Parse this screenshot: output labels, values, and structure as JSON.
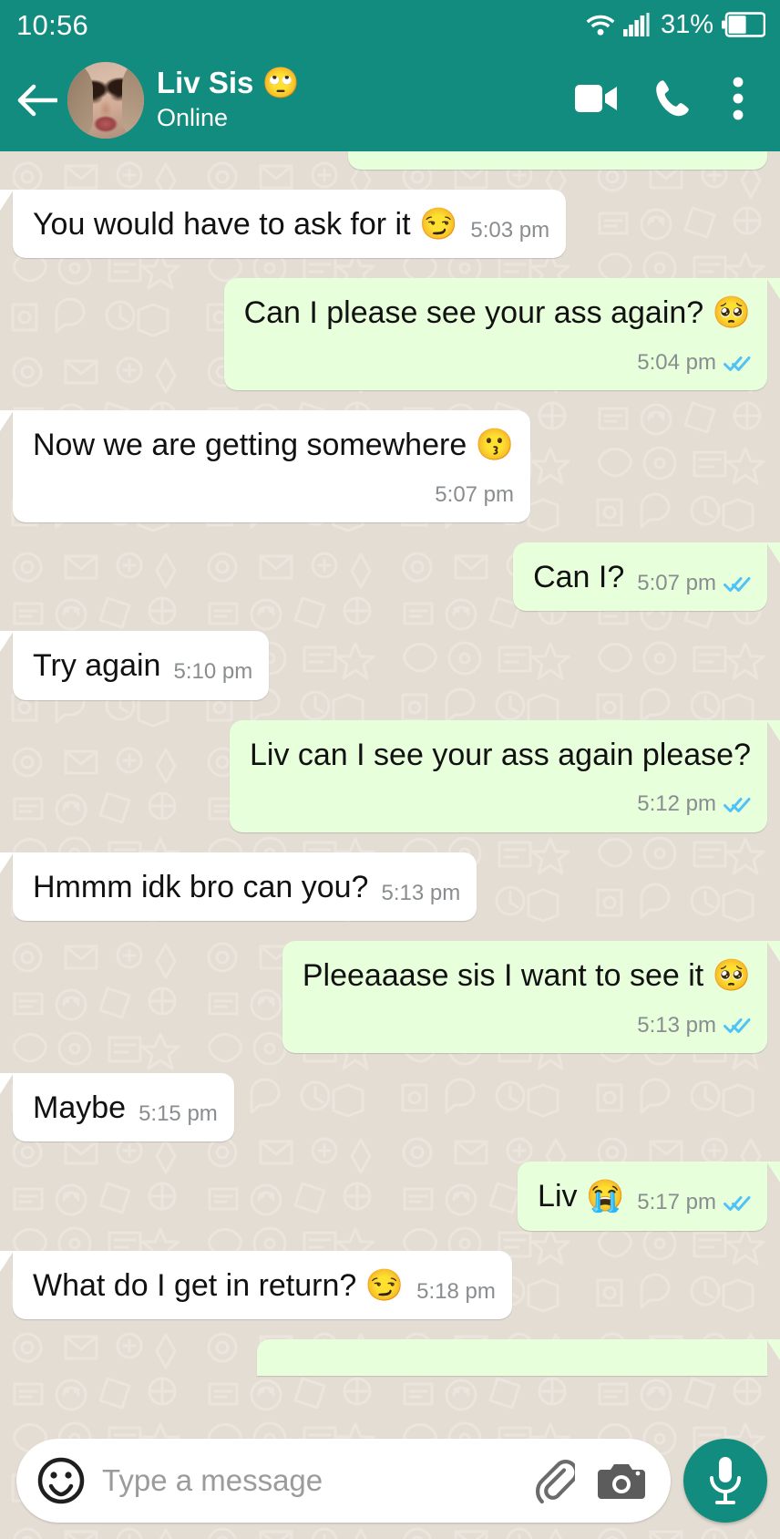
{
  "status_bar": {
    "clock": "10:56",
    "battery_percent": "31%",
    "battery_level": 31,
    "wifi_icon": "wifi-icon",
    "signal_icon": "signal-bars-icon",
    "battery_icon": "battery-icon"
  },
  "header": {
    "back_icon": "back-arrow-icon",
    "avatar_name": "avatar",
    "contact_name": "Liv Sis 🙄",
    "status": "Online",
    "video_call_icon": "video-call-icon",
    "voice_call_icon": "phone-call-icon",
    "overflow_icon": "more-options-icon",
    "accent_color": "#128C7E"
  },
  "chat": {
    "background_color": "#E4DDD4",
    "incoming_bubble_color": "#FFFFFF",
    "outgoing_bubble_color": "#E7FFDB",
    "read_tick_color": "#4FC3F7",
    "messages": [
      {
        "id": "m0",
        "direction": "out",
        "text": "",
        "time": "",
        "ticks": "read",
        "clipped": true,
        "meta_layout": "none"
      },
      {
        "id": "m1",
        "direction": "in",
        "text": "You would have to ask for it 😏",
        "time": "5:03 pm",
        "ticks": "none",
        "meta_layout": "inline"
      },
      {
        "id": "m2",
        "direction": "out",
        "text": "Can I please see your ass again? 🥺",
        "time": "5:04 pm",
        "ticks": "read",
        "meta_layout": "block"
      },
      {
        "id": "m3",
        "direction": "in",
        "text": "Now we are getting somewhere 😗",
        "time": "5:07 pm",
        "ticks": "none",
        "meta_layout": "block"
      },
      {
        "id": "m4",
        "direction": "out",
        "text": "Can I?",
        "time": "5:07 pm",
        "ticks": "read",
        "meta_layout": "inline"
      },
      {
        "id": "m5",
        "direction": "in",
        "text": "Try again",
        "time": "5:10 pm",
        "ticks": "none",
        "meta_layout": "inline"
      },
      {
        "id": "m6",
        "direction": "out",
        "text": "Liv can I see your ass again please?",
        "time": "5:12 pm",
        "ticks": "read",
        "meta_layout": "block"
      },
      {
        "id": "m7",
        "direction": "in",
        "text": "Hmmm idk bro can you?",
        "time": "5:13 pm",
        "ticks": "none",
        "meta_layout": "inline"
      },
      {
        "id": "m8",
        "direction": "out",
        "text": "Pleeaaase sis I want to see it 🥺",
        "time": "5:13 pm",
        "ticks": "read",
        "meta_layout": "block"
      },
      {
        "id": "m9",
        "direction": "in",
        "text": "Maybe",
        "time": "5:15 pm",
        "ticks": "none",
        "meta_layout": "inline"
      },
      {
        "id": "m10",
        "direction": "out",
        "text": "Liv 😭",
        "time": "5:17 pm",
        "ticks": "read",
        "meta_layout": "inline"
      },
      {
        "id": "m11",
        "direction": "in",
        "text": "What do I get in return? 😏",
        "time": "5:18 pm",
        "ticks": "none",
        "meta_layout": "inline"
      }
    ]
  },
  "input_bar": {
    "emoji_icon": "emoji-smiley-icon",
    "placeholder": "Type a message",
    "value": "",
    "attach_icon": "paperclip-attach-icon",
    "camera_icon": "camera-icon",
    "mic_icon": "microphone-icon",
    "mic_button_color": "#128C7E"
  }
}
